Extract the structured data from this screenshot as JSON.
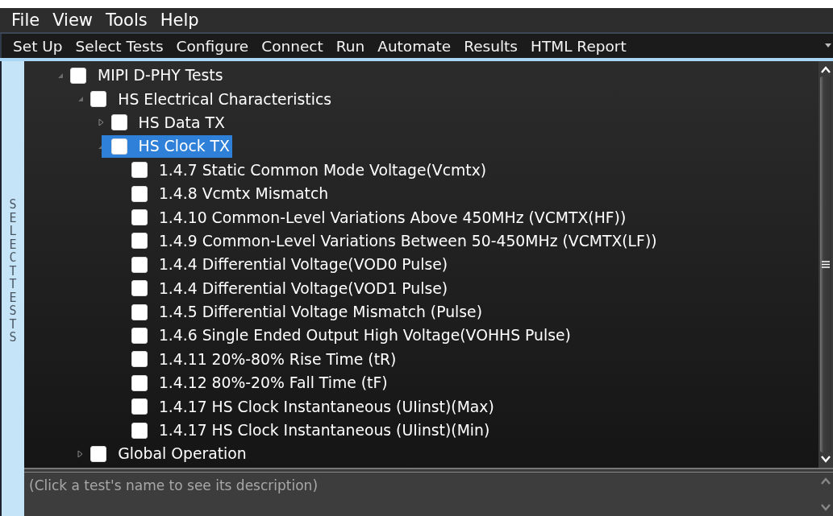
{
  "menu": [
    {
      "label": "File"
    },
    {
      "label": "View"
    },
    {
      "label": "Tools"
    },
    {
      "label": "Help"
    }
  ],
  "tabs": [
    {
      "label": "Set Up"
    },
    {
      "label": "Select Tests"
    },
    {
      "label": "Configure"
    },
    {
      "label": "Connect"
    },
    {
      "label": "Run"
    },
    {
      "label": "Automate"
    },
    {
      "label": "Results"
    },
    {
      "label": "HTML Report"
    }
  ],
  "side_panel": {
    "label": "SELECT TESTS"
  },
  "tree": [
    {
      "label": "MIPI D-PHY Tests",
      "checked": false,
      "expanded": true,
      "selected": false,
      "children": [
        {
          "label": "HS Electrical Characteristics",
          "checked": false,
          "expanded": true,
          "selected": false,
          "children": [
            {
              "label": "HS Data TX",
              "checked": false,
              "expanded": false,
              "selected": false
            },
            {
              "label": "HS Clock TX",
              "checked": false,
              "expanded": true,
              "selected": true,
              "children": [
                {
                  "label": "1.4.7 Static Common Mode Voltage(Vcmtx)",
                  "checked": false,
                  "selected": false
                },
                {
                  "label": "1.4.8 Vcmtx Mismatch",
                  "checked": false,
                  "selected": false
                },
                {
                  "label": "1.4.10 Common-Level Variations Above 450MHz (VCMTX(HF))",
                  "checked": false,
                  "selected": false
                },
                {
                  "label": "1.4.9 Common-Level Variations Between 50-450MHz (VCMTX(LF))",
                  "checked": false,
                  "selected": false
                },
                {
                  "label": "1.4.4 Differential Voltage(VOD0 Pulse)",
                  "checked": false,
                  "selected": false
                },
                {
                  "label": "1.4.4 Differential Voltage(VOD1 Pulse)",
                  "checked": false,
                  "selected": false
                },
                {
                  "label": "1.4.5 Differential Voltage Mismatch (Pulse)",
                  "checked": false,
                  "selected": false
                },
                {
                  "label": "1.4.6 Single Ended Output High Voltage(VOHHS Pulse)",
                  "checked": false,
                  "selected": false
                },
                {
                  "label": "1.4.11 20%-80% Rise Time (tR)",
                  "checked": false,
                  "selected": false
                },
                {
                  "label": "1.4.12 80%-20% Fall Time (tF)",
                  "checked": false,
                  "selected": false
                },
                {
                  "label": "1.4.17 HS Clock Instantaneous (UIinst)(Max)",
                  "checked": false,
                  "selected": false
                },
                {
                  "label": "1.4.17 HS Clock Instantaneous (UIinst)(Min)",
                  "checked": false,
                  "selected": false
                }
              ]
            }
          ]
        },
        {
          "label": "Global Operation",
          "checked": false,
          "expanded": false,
          "selected": false
        }
      ]
    }
  ],
  "description": {
    "placeholder": "(Click a test's name to see its description)"
  }
}
